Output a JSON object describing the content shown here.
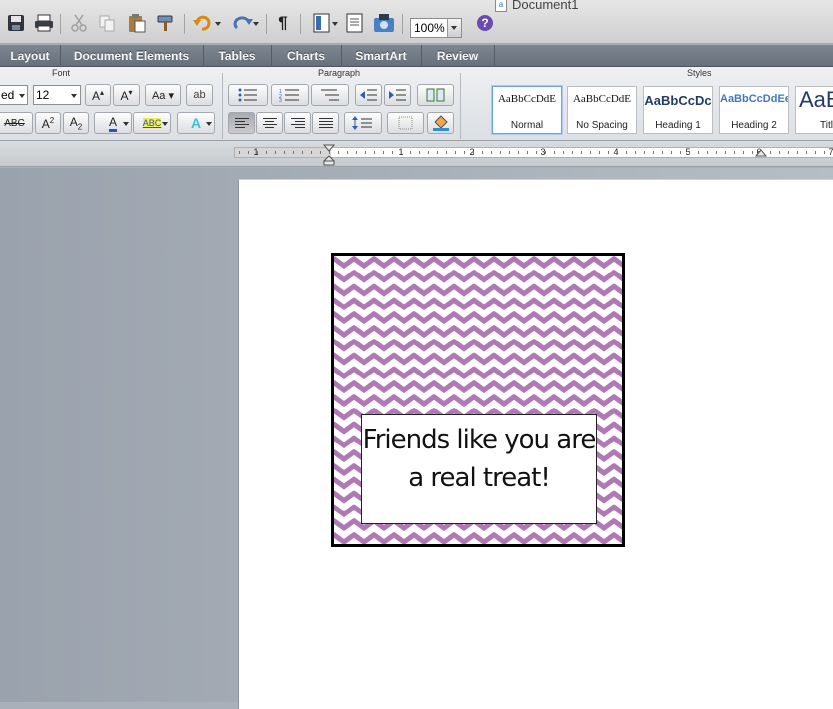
{
  "window": {
    "document_title": "Document1"
  },
  "toolbar": {
    "zoom": "100%"
  },
  "tabs": [
    {
      "label": "Layout"
    },
    {
      "label": "Document Elements"
    },
    {
      "label": "Tables"
    },
    {
      "label": "Charts"
    },
    {
      "label": "SmartArt"
    },
    {
      "label": "Review"
    }
  ],
  "ribbon": {
    "font": {
      "group_title": "Font",
      "font_name": "ed",
      "font_size": "12",
      "strike_label": "ABC",
      "highlight_label": "ABC"
    },
    "paragraph": {
      "group_title": "Paragraph"
    },
    "styles": {
      "group_title": "Styles",
      "items": [
        {
          "sample": "AaBbCcDdE",
          "caption": "Normal",
          "selected": true
        },
        {
          "sample": "AaBbCcDdE",
          "caption": "No Spacing"
        },
        {
          "sample": "AaBbCcDc",
          "caption": "Heading 1"
        },
        {
          "sample": "AaBbCcDdEe",
          "caption": "Heading 2"
        },
        {
          "sample": "AaBl",
          "caption": "Titl"
        }
      ]
    }
  },
  "ruler": {
    "numbers": [
      "1",
      "1",
      "2",
      "3",
      "4",
      "5",
      "6",
      "7"
    ]
  },
  "document": {
    "tag_text_line1": "Friends like you are",
    "tag_text_line2": "a real treat!",
    "chevron_color": "#b078b5"
  }
}
